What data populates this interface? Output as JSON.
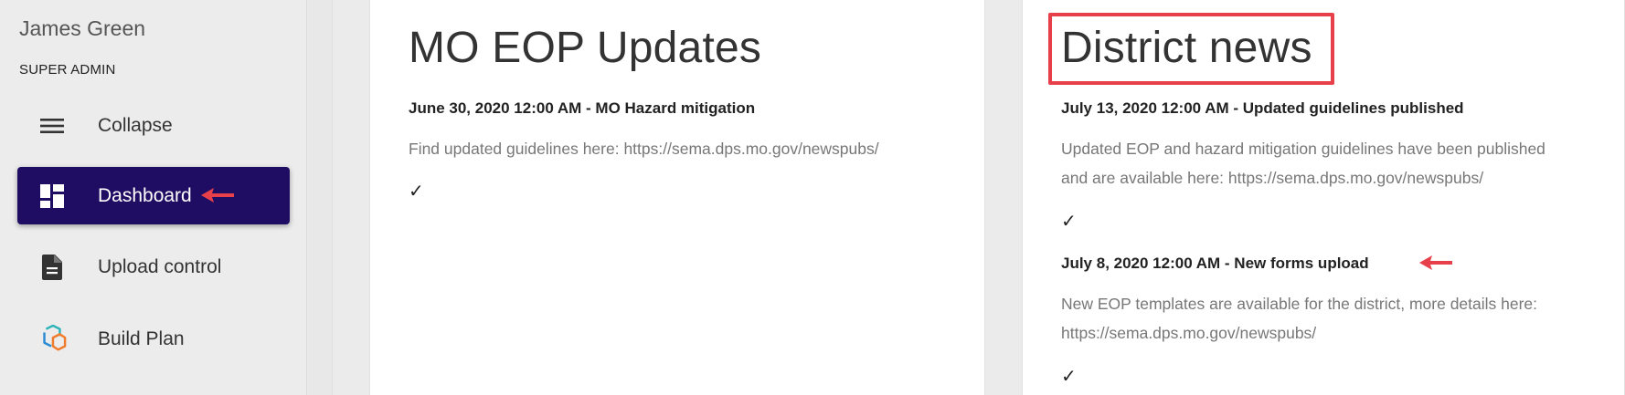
{
  "sidebar": {
    "user_name": "James Green",
    "user_role": "SUPER ADMIN",
    "items": [
      {
        "label": "Collapse",
        "icon": "menu-icon",
        "active": false
      },
      {
        "label": "Dashboard",
        "icon": "dashboard-icon",
        "active": true
      },
      {
        "label": "Upload control",
        "icon": "document-icon",
        "active": false
      },
      {
        "label": "Build Plan",
        "icon": "build-plan-logo-icon",
        "active": false
      }
    ]
  },
  "cards": [
    {
      "title": "MO EOP Updates",
      "news": [
        {
          "heading": "June 30, 2020 12:00 AM - MO Hazard mitigation",
          "body": "Find updated guidelines here: https://sema.dps.mo.gov/newspubs/",
          "check": "✓"
        }
      ]
    },
    {
      "title": "District news",
      "news": [
        {
          "heading": "July 13, 2020 12:00 AM - Updated guidelines published",
          "body_line1": "Updated EOP and hazard mitigation guidelines have been published",
          "body_line2": "and are available here: https://sema.dps.mo.gov/newspubs/",
          "check": "✓"
        },
        {
          "heading": "July 8, 2020 12:00 AM - New forms upload",
          "body_line1": "New EOP templates are available for the district, more details here:",
          "body_line2": "https://sema.dps.mo.gov/newspubs/",
          "check": "✓"
        }
      ]
    }
  ],
  "colors": {
    "active_nav_bg": "#1f0d63",
    "annotation_red": "#e8404a"
  }
}
